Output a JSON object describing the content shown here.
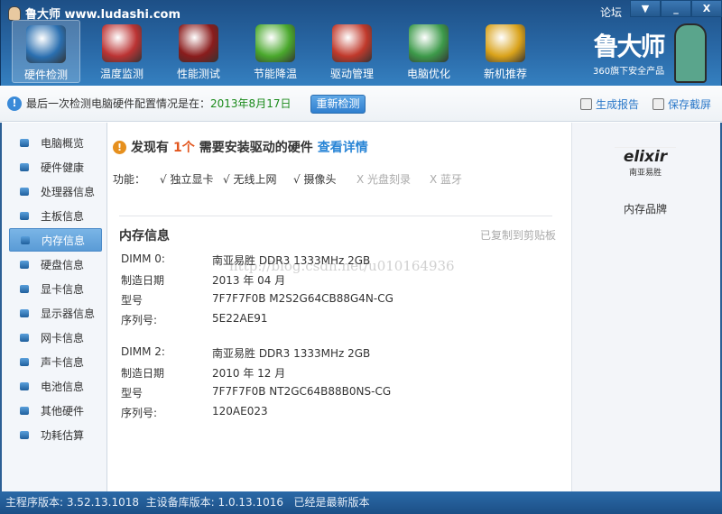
{
  "app": {
    "title": "鲁大师 www.ludashi.com",
    "forum": "论坛",
    "window_buttons": [
      "▼",
      "_",
      "X"
    ]
  },
  "nav": [
    {
      "label": "硬件检测",
      "icon": "monitor-magnifier-icon",
      "color": "#2a6fb0"
    },
    {
      "label": "温度监测",
      "icon": "thermometer-icon",
      "color": "#b33"
    },
    {
      "label": "性能测试",
      "icon": "speedometer-icon",
      "color": "#8a1c1c"
    },
    {
      "label": "节能降温",
      "icon": "clover-icon",
      "color": "#4aa82c"
    },
    {
      "label": "驱动管理",
      "icon": "driver-box-icon",
      "color": "#c0392b"
    },
    {
      "label": "电脑优化",
      "icon": "monitor-wand-icon",
      "color": "#3d9a4a"
    },
    {
      "label": "新机推荐",
      "icon": "monitor-medal-icon",
      "color": "#d9a21a"
    }
  ],
  "brand": {
    "name": "鲁大师",
    "sub": "360旗下安全产品"
  },
  "toolbar": {
    "message": "最后一次检测电脑硬件配置情况是在：",
    "date": "2013年8月17日",
    "recheck": "重新检测",
    "report": "生成报告",
    "screenshot": "保存截屏"
  },
  "sidebar": [
    "电脑概览",
    "硬件健康",
    "处理器信息",
    "主板信息",
    "内存信息",
    "硬盘信息",
    "显卡信息",
    "显示器信息",
    "网卡信息",
    "声卡信息",
    "电池信息",
    "其他硬件",
    "功耗估算"
  ],
  "sidebar_selected": 4,
  "main": {
    "warn_pre": "发现有",
    "warn_count": "1个",
    "warn_post": "需要安装驱动的硬件",
    "warn_link": "查看详情",
    "features_label": "功能：",
    "features": [
      {
        "name": "√ 独立显卡",
        "on": true
      },
      {
        "name": "√ 无线上网",
        "on": true
      },
      {
        "name": "√ 摄像头",
        "on": true
      },
      {
        "name": "X 光盘刻录",
        "on": false
      },
      {
        "name": "X 蓝牙",
        "on": false
      }
    ],
    "section_title": "内存信息",
    "copied": "已复制到剪贴板",
    "watermark": "http://blog.csdn.net/u010164936",
    "rows": [
      [
        "DIMM 0:",
        "南亚易胜 DDR3 1333MHz 2GB"
      ],
      [
        "制造日期",
        "2013 年 04 月"
      ],
      [
        "型号",
        "7F7F7F0B M2S2G64CB88G4N-CG"
      ],
      [
        "序列号:",
        "5E22AE91"
      ],
      [
        "DIMM 2:",
        "南亚易胜 DDR3 1333MHz 2GB"
      ],
      [
        "制造日期",
        "2010 年 12 月"
      ],
      [
        "型号",
        "7F7F7F0B NT2GC64B88B0NS-CG"
      ],
      [
        "序列号:",
        "120AE023"
      ]
    ]
  },
  "right": {
    "logo": "elixir",
    "logo_sub": "南亚易胜",
    "label": "内存品牌"
  },
  "status": {
    "main_version": "主程序版本: 3.52.13.1018",
    "db_version": "主设备库版本: 1.0.13.1016",
    "latest": "已经是最新版本"
  }
}
